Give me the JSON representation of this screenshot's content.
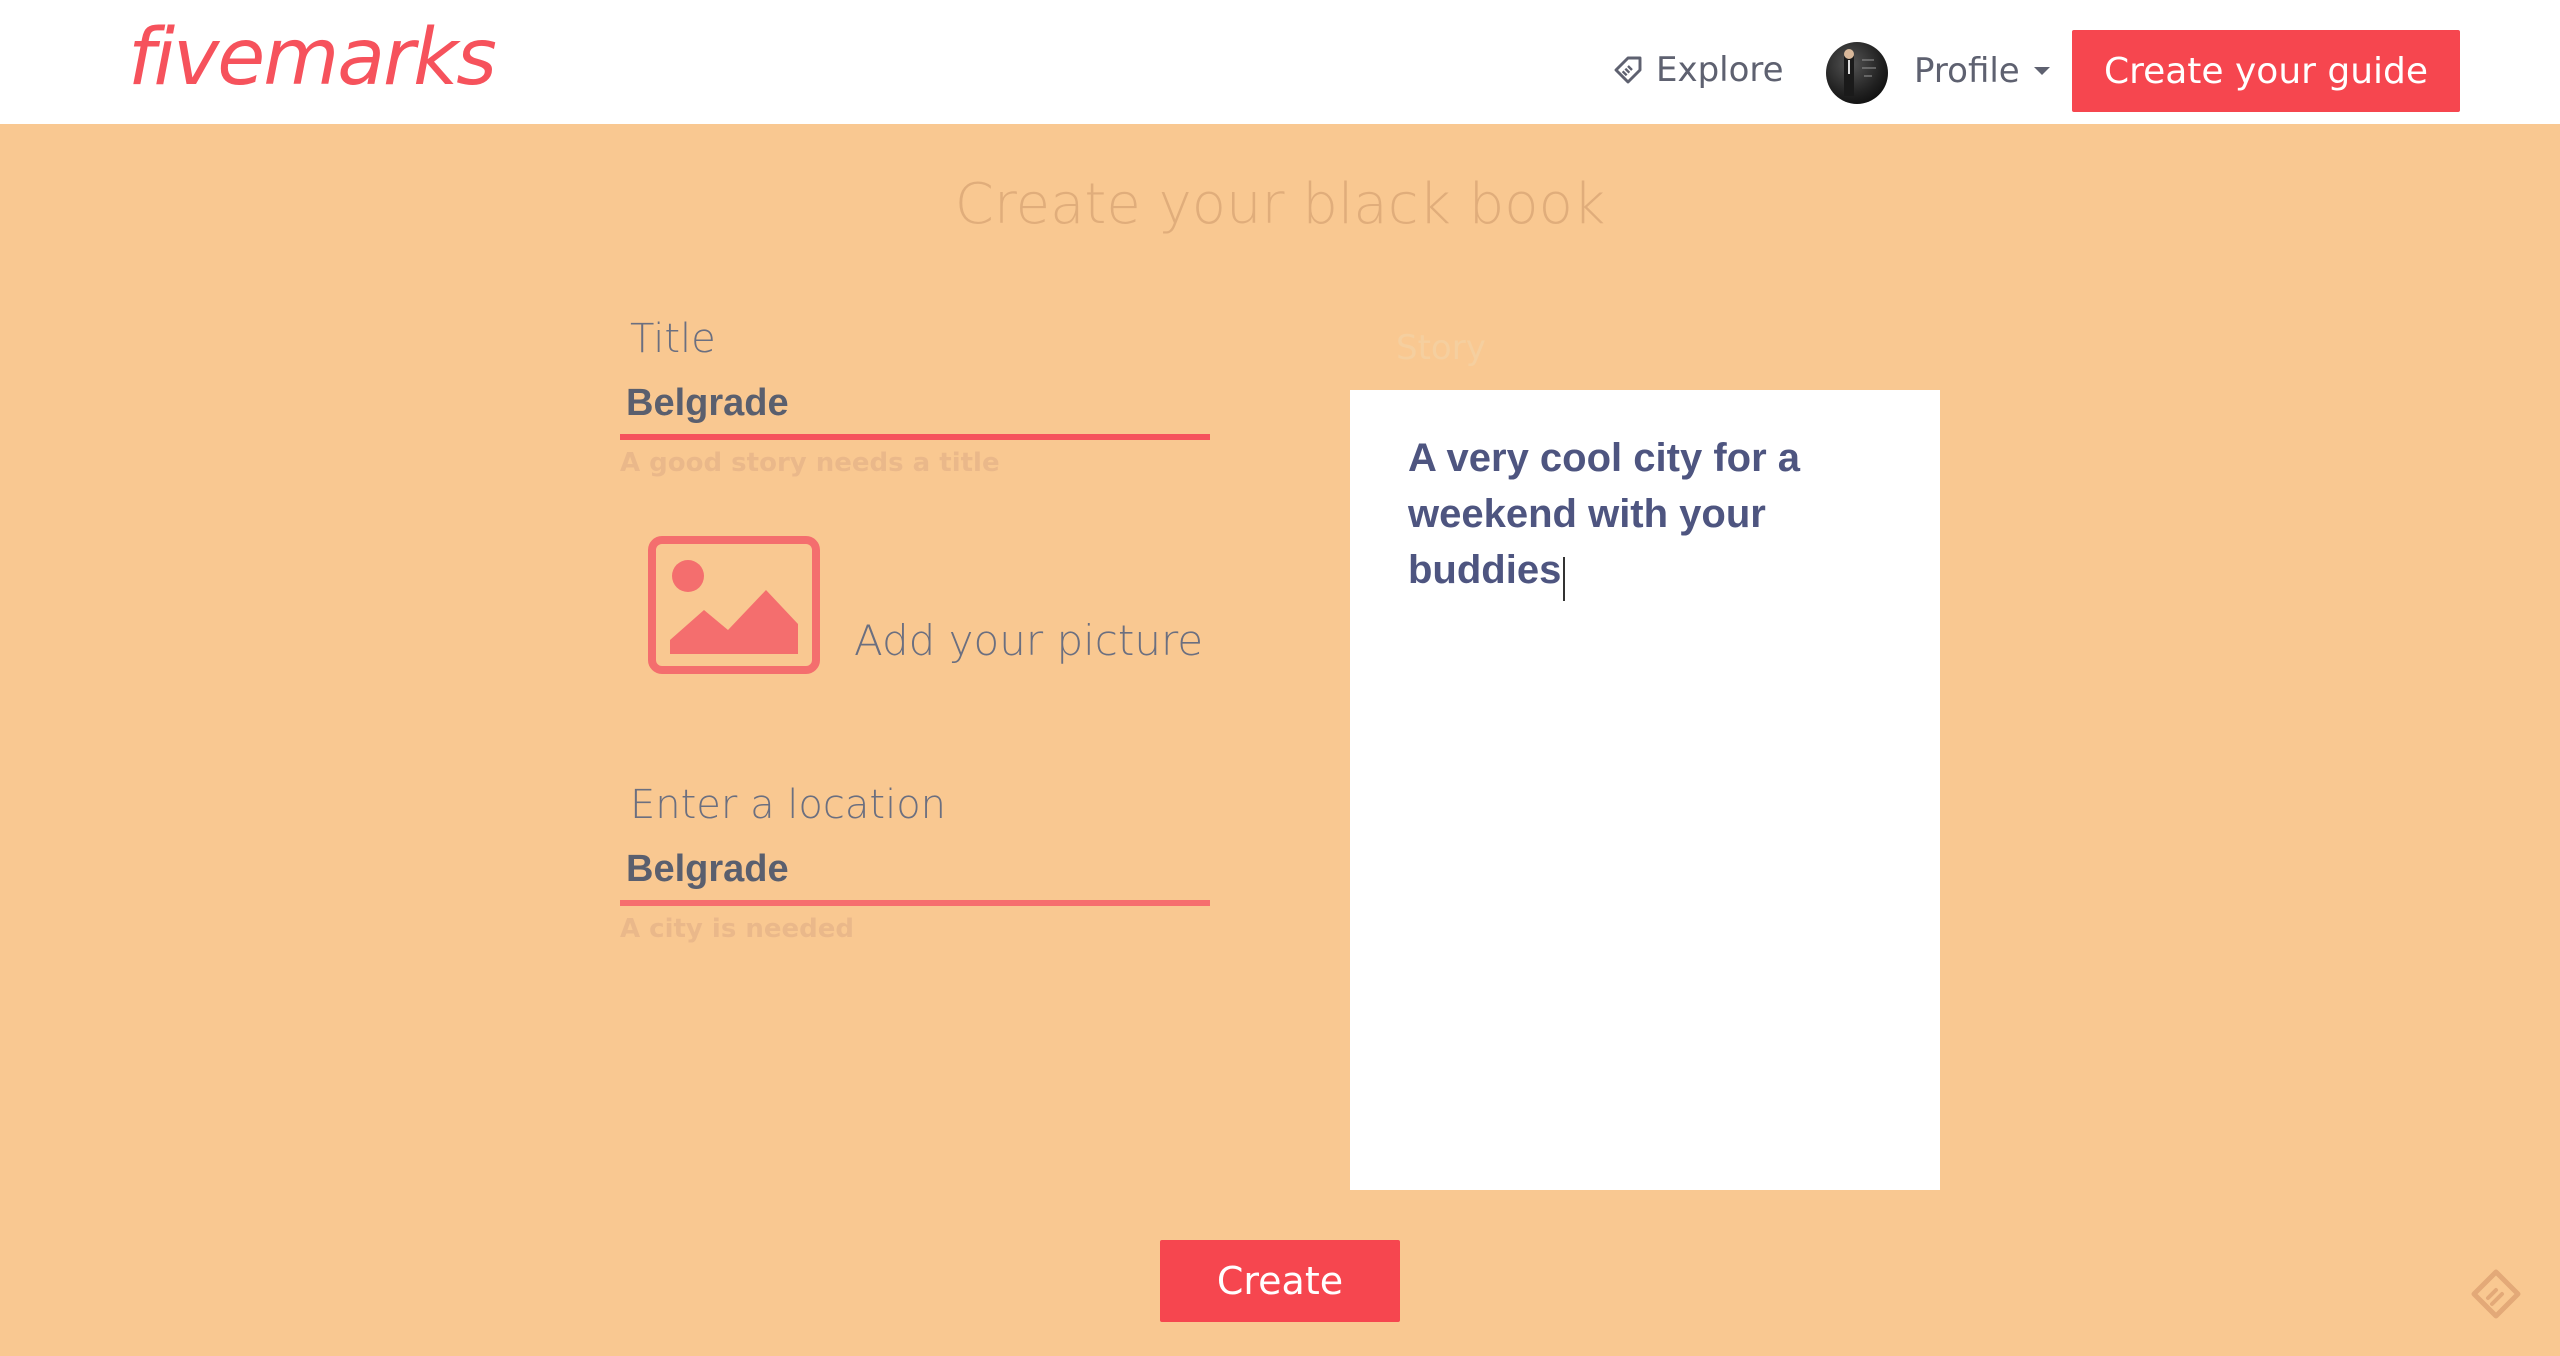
{
  "header": {
    "logo": "fivemarks",
    "explore_label": "Explore",
    "profile_label": "Profile",
    "create_guide_label": "Create your guide"
  },
  "main": {
    "page_title": "Create your black book",
    "title_field": {
      "label": "Title",
      "value": "Belgrade",
      "hint": "A good story needs a title"
    },
    "picture": {
      "label": "Add your picture"
    },
    "location_field": {
      "label": "Enter a location",
      "value": "Belgrade",
      "hint": "A city is needed"
    },
    "story": {
      "label": "Story",
      "text": "A very cool city for a weekend with your buddies"
    },
    "create_label": "Create"
  },
  "colors": {
    "brand": "#f6525c",
    "background": "#f9c891",
    "button": "#f6464f"
  }
}
